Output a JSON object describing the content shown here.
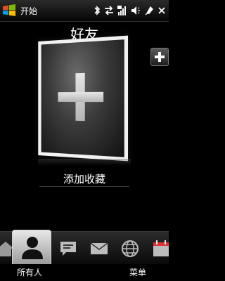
{
  "status_bar": {
    "start_label": "开始",
    "icons": [
      "bluetooth-icon",
      "data-transfer-icon",
      "signal-icon",
      "volume-icon",
      "battery-charging-icon",
      "close-icon"
    ]
  },
  "main": {
    "title": "好友",
    "card_caption": "添加收藏"
  },
  "tabs": [
    {
      "name": "home-tab",
      "icon": "home-icon"
    },
    {
      "name": "people-tab",
      "icon": "person-icon",
      "selected": true
    },
    {
      "name": "messages-tab",
      "icon": "message-icon"
    },
    {
      "name": "mail-tab",
      "icon": "mail-icon"
    },
    {
      "name": "internet-tab",
      "icon": "globe-icon"
    },
    {
      "name": "calendar-tab",
      "icon": "calendar-icon"
    }
  ],
  "softkeys": {
    "left": "所有人",
    "right": "菜单"
  },
  "colors": {
    "background": "#000000",
    "tab_selected": "#d0d0d0",
    "text": "#ffffff"
  }
}
